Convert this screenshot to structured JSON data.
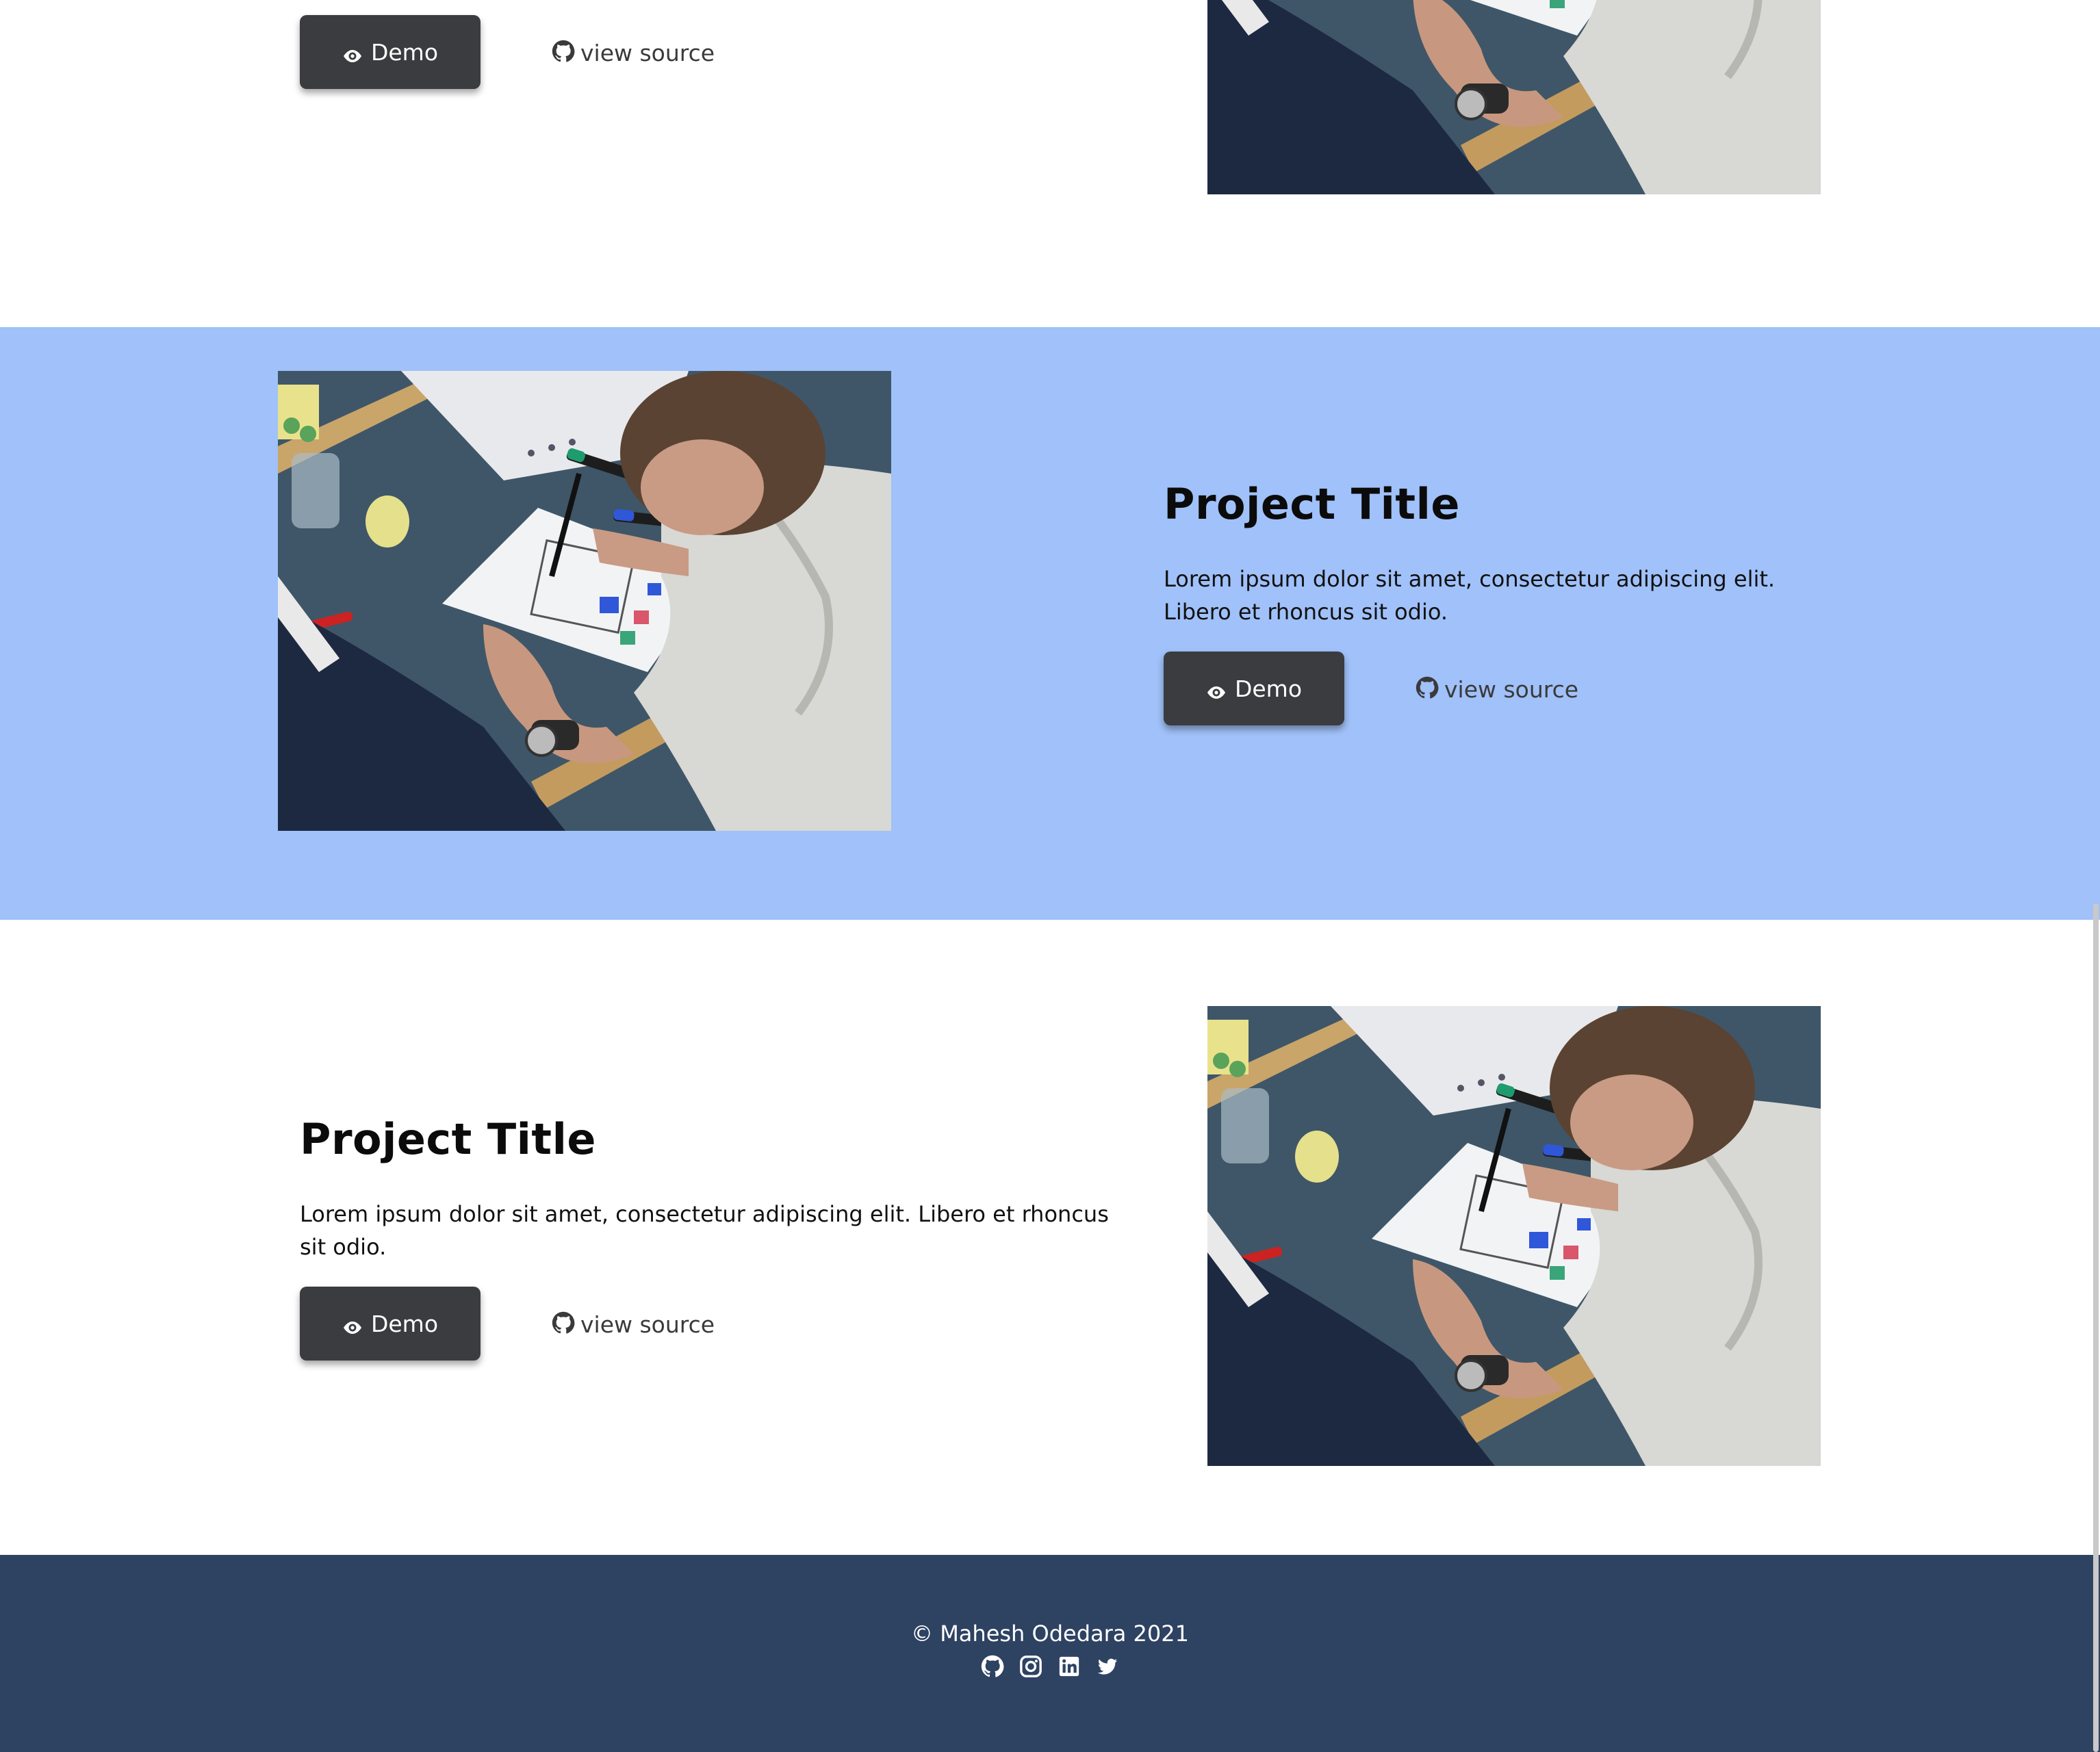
{
  "projects": [
    {
      "title": "",
      "description": "",
      "demo_label": "Demo",
      "source_label": "view source"
    },
    {
      "title": "Project Title",
      "description": "Lorem ipsum dolor sit amet, consectetur adipiscing elit. Libero et rhoncus sit odio.",
      "demo_label": "Demo",
      "source_label": "view source"
    },
    {
      "title": "Project Title",
      "description": "Lorem ipsum dolor sit amet, consectetur adipiscing elit. Libero et rhoncus sit odio.",
      "demo_label": "Demo",
      "source_label": "view source"
    }
  ],
  "footer": {
    "copyright": "© Mahesh Odedara 2021",
    "social_icons": [
      "github-icon",
      "instagram-icon",
      "linkedin-icon",
      "twitter-icon"
    ]
  },
  "colors": {
    "highlight_section": "#a0c1f9",
    "footer_bg": "#2e4262",
    "button_bg": "#3b3c3f"
  }
}
